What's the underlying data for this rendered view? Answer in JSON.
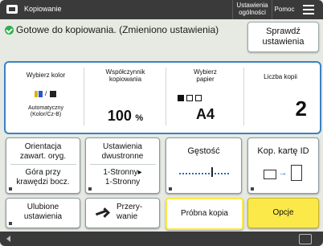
{
  "header": {
    "app_title": "Kopiowanie",
    "settings_btn": "Ustawienia ogólności",
    "help_btn": "Pomoc"
  },
  "status_text": "Gotowe do kopiowania. (Zmieniono ustawienia)",
  "check_btn": "Sprawdź ustawienia",
  "panel": {
    "color": {
      "title": "Wybierz kolor",
      "value": "Automatyczny (Kolor/Cz-B)"
    },
    "ratio": {
      "title": "Współczynnik kopiowania",
      "value": "100",
      "unit": "%"
    },
    "paper": {
      "title": "Wybierz papier",
      "value": "A4"
    },
    "copies": {
      "title": "Liczba kopii",
      "value": "2"
    }
  },
  "row2": {
    "orient": {
      "line1": "Orientacja zawart. oryg.",
      "line2": "Góra przy krawędzi bocz."
    },
    "duplex": {
      "line1": "Ustawienia dwustronne",
      "line2": "1-Stronny▸ 1-Stronny"
    },
    "density": {
      "label": "Gęstość"
    },
    "idcard": {
      "label": "Kop. kartę ID"
    }
  },
  "row3": {
    "favorites": "Ulubione ustawienia",
    "interrupt": "Przery- wanie",
    "sample": "Próbna kopia",
    "options": "Opcje"
  },
  "colors": {
    "accent_blue": "#3b82c4",
    "options_yellow": "#fbe94a",
    "status_green": "#2eae4e"
  }
}
